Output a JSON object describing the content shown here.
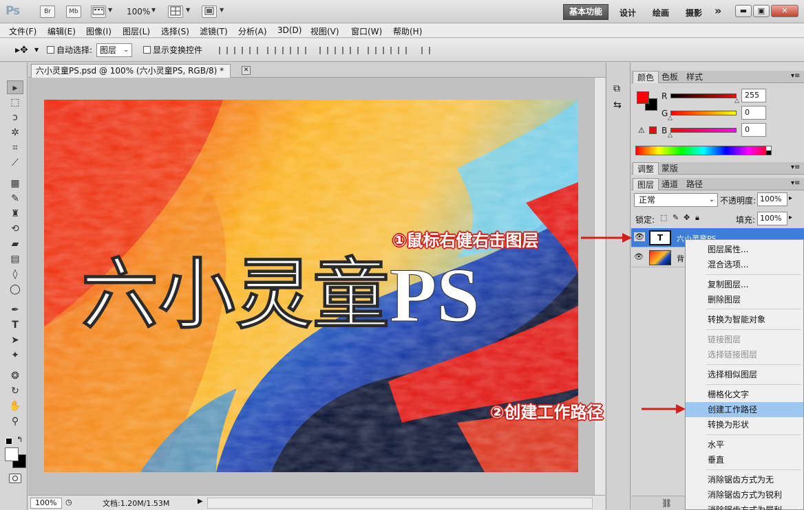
{
  "titlebar": {
    "app_logo": "Ps",
    "br_label": "Br",
    "mb_label": "Mb",
    "zoom": "100%",
    "workspaces": [
      "基本功能",
      "设计",
      "绘画",
      "摄影"
    ],
    "more": "»"
  },
  "menu": [
    "文件(F)",
    "编辑(E)",
    "图像(I)",
    "图层(L)",
    "选择(S)",
    "滤镜(T)",
    "分析(A)",
    "3D(D)",
    "视图(V)",
    "窗口(W)",
    "帮助(H)"
  ],
  "options": {
    "auto_select_label": "自动选择:",
    "auto_select_value": "图层",
    "show_transform_label": "显示变换控件"
  },
  "document": {
    "tab_title": "六小灵童PS.psd @ 100% (六小灵童PS, RGB/8) *",
    "canvas_text": "六小灵童PS"
  },
  "status": {
    "zoom": "100%",
    "doc_info": "文档:1.20M/1.53M"
  },
  "color_panel": {
    "tabs": [
      "颜色",
      "色板",
      "样式"
    ],
    "channels": [
      {
        "label": "R",
        "value": "255"
      },
      {
        "label": "G",
        "value": "0"
      },
      {
        "label": "B",
        "value": "0"
      }
    ],
    "fg_color": "#ff0000",
    "bg_color": "#000000"
  },
  "adjust_panel": {
    "tabs": [
      "调整",
      "蒙版"
    ]
  },
  "layers_panel": {
    "tabs": [
      "图层",
      "通道",
      "路径"
    ],
    "blend_mode": "正常",
    "opacity_label": "不透明度:",
    "opacity_value": "100%",
    "lock_label": "锁定:",
    "fill_label": "填充:",
    "fill_value": "100%",
    "layers": [
      {
        "name": "六小灵童PS",
        "type": "text",
        "thumb": "T",
        "selected": true
      },
      {
        "name": "背",
        "type": "image",
        "selected": false
      }
    ]
  },
  "context_menu": {
    "items": [
      {
        "label": "图层属性...",
        "disabled": false
      },
      {
        "label": "混合选项...",
        "disabled": false
      },
      {
        "sep": true
      },
      {
        "label": "复制图层...",
        "disabled": false
      },
      {
        "label": "删除图层",
        "disabled": false
      },
      {
        "sep": true
      },
      {
        "label": "转换为智能对象",
        "disabled": false
      },
      {
        "sep": true
      },
      {
        "label": "链接图层",
        "disabled": true
      },
      {
        "label": "选择链接图层",
        "disabled": true
      },
      {
        "sep": true
      },
      {
        "label": "选择相似图层",
        "disabled": false
      },
      {
        "sep": true
      },
      {
        "label": "栅格化文字",
        "disabled": false
      },
      {
        "label": "创建工作路径",
        "disabled": false,
        "highlighted": true
      },
      {
        "label": "转换为形状",
        "disabled": false
      },
      {
        "sep": true
      },
      {
        "label": "水平",
        "disabled": false
      },
      {
        "label": "垂直",
        "disabled": false
      },
      {
        "sep": true
      },
      {
        "label": "消除锯齿方式为无",
        "disabled": false
      },
      {
        "label": "消除锯齿方式为锐利",
        "disabled": false
      },
      {
        "label": "消除锯齿方式为犀利",
        "disabled": false
      }
    ]
  },
  "annotations": {
    "step1": "①鼠标右健右击图层",
    "step2": "②创建工作路径",
    "color": "#d0201a"
  }
}
